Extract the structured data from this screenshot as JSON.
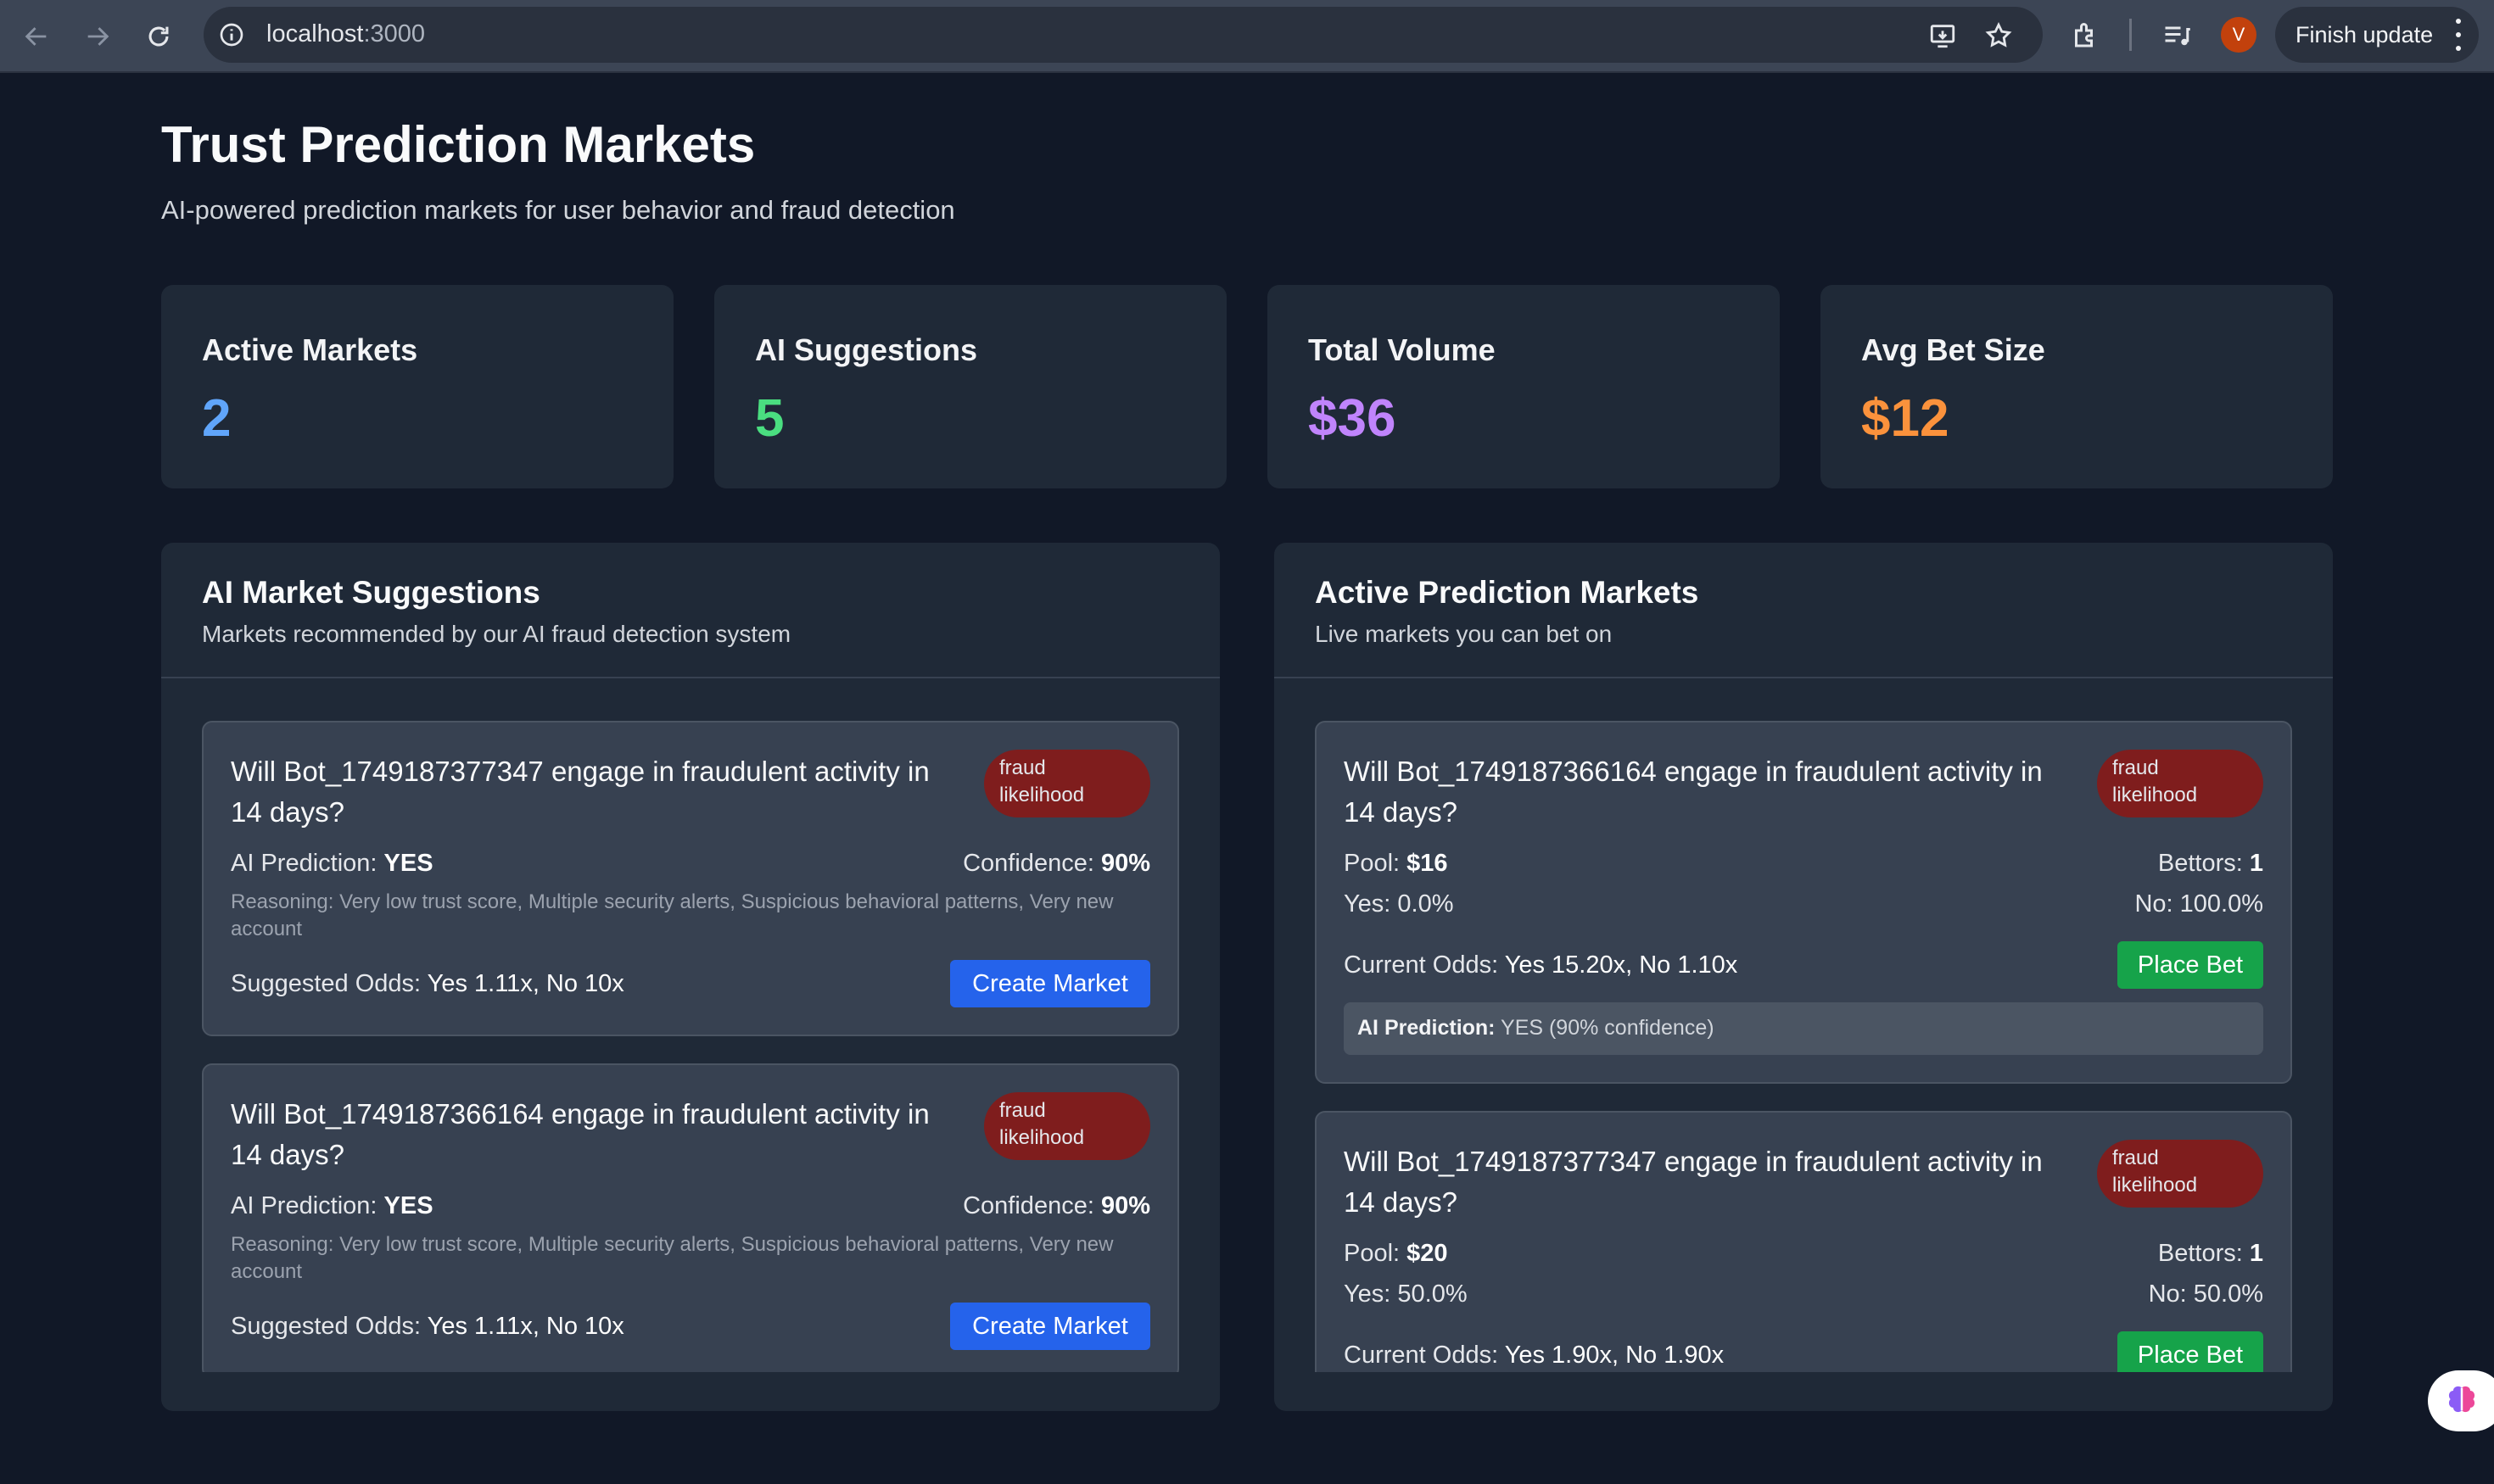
{
  "browser": {
    "url_host": "localhost",
    "url_port": ":3000",
    "finish_update_label": "Finish update",
    "profile_initial": "V"
  },
  "page": {
    "title": "Trust Prediction Markets",
    "subtitle": "AI-powered prediction markets for user behavior and fraud detection"
  },
  "stats": [
    {
      "label": "Active Markets",
      "value": "2",
      "color": "#60a5fa"
    },
    {
      "label": "AI Suggestions",
      "value": "5",
      "color": "#4ade80"
    },
    {
      "label": "Total Volume",
      "value": "$36",
      "color": "#c084fc"
    },
    {
      "label": "Avg Bet Size",
      "value": "$12",
      "color": "#fb923c"
    }
  ],
  "suggestions": {
    "title": "AI Market Suggestions",
    "subtitle": "Markets recommended by our AI fraud detection system",
    "items": [
      {
        "question": "Will Bot_1749187377347 engage in fraudulent activity in 14 days?",
        "badge_line1": "fraud",
        "badge_line2": "likelihood",
        "prediction_label": "AI Prediction:",
        "prediction": "YES",
        "confidence_label": "Confidence:",
        "confidence": "90%",
        "reasoning": "Reasoning: Very low trust score, Multiple security alerts, Suspicious behavioral patterns, Very new account",
        "odds_label": "Suggested Odds:",
        "odds": "Yes 1.11x, No 10x",
        "button": "Create Market"
      },
      {
        "question": "Will Bot_1749187366164 engage in fraudulent activity in 14 days?",
        "badge_line1": "fraud",
        "badge_line2": "likelihood",
        "prediction_label": "AI Prediction:",
        "prediction": "YES",
        "confidence_label": "Confidence:",
        "confidence": "90%",
        "reasoning": "Reasoning: Very low trust score, Multiple security alerts, Suspicious behavioral patterns, Very new account",
        "odds_label": "Suggested Odds:",
        "odds": "Yes 1.11x, No 10x",
        "button": "Create Market"
      }
    ]
  },
  "markets": {
    "title": "Active Prediction Markets",
    "subtitle": "Live markets you can bet on",
    "items": [
      {
        "question": "Will Bot_1749187366164 engage in fraudulent activity in 14 days?",
        "badge_line1": "fraud",
        "badge_line2": "likelihood",
        "pool_label": "Pool:",
        "pool": "$16",
        "bettors_label": "Bettors:",
        "bettors": "1",
        "yes": "Yes: 0.0%",
        "no": "No: 100.0%",
        "odds_label": "Current Odds:",
        "odds": "Yes 15.20x, No 1.10x",
        "button": "Place Bet",
        "ai_label": "AI Prediction:",
        "ai_value": "YES (90% confidence)"
      },
      {
        "question": "Will Bot_1749187377347 engage in fraudulent activity in 14 days?",
        "badge_line1": "fraud",
        "badge_line2": "likelihood",
        "pool_label": "Pool:",
        "pool": "$20",
        "bettors_label": "Bettors:",
        "bettors": "1",
        "yes": "Yes: 50.0%",
        "no": "No: 50.0%",
        "odds_label": "Current Odds:",
        "odds": "Yes 1.90x, No 1.90x",
        "button": "Place Bet"
      }
    ]
  }
}
